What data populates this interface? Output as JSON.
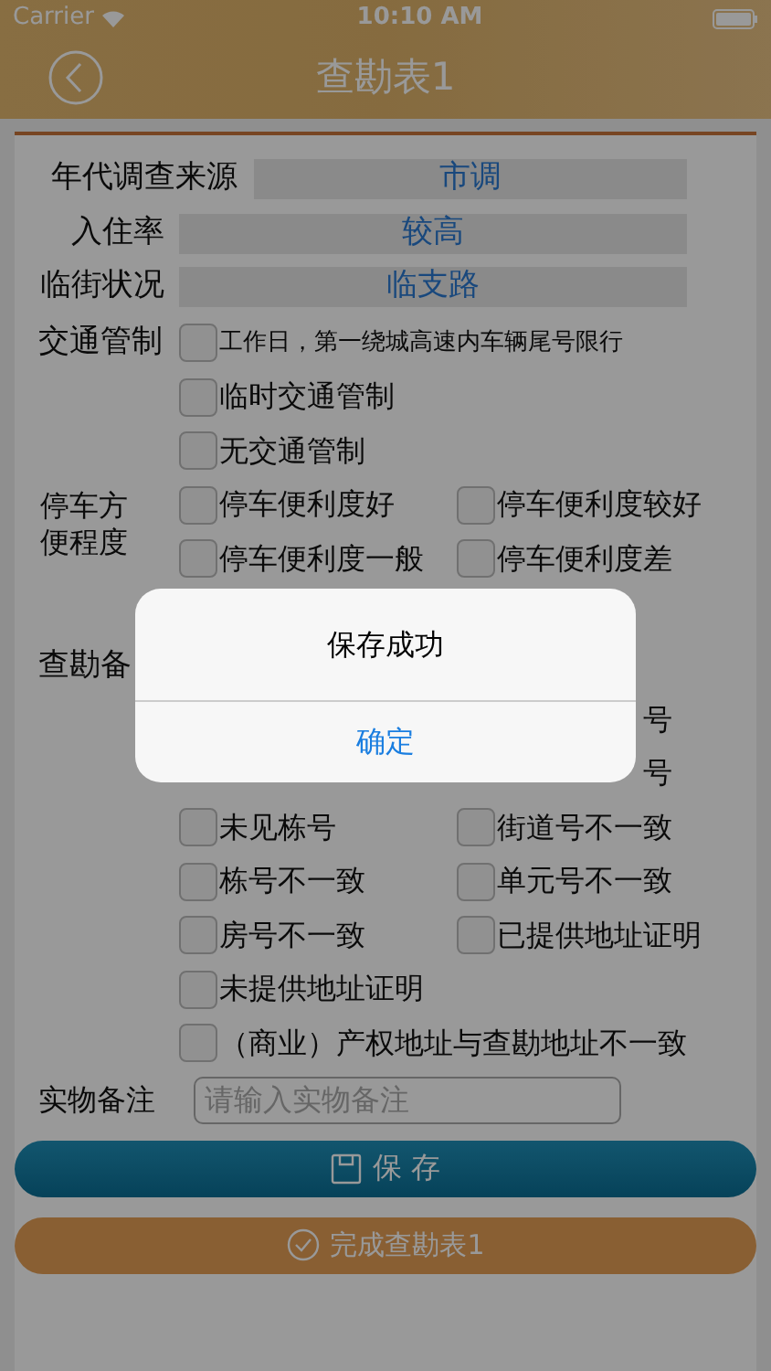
{
  "status_bar": {
    "carrier": "Carrier",
    "time": "10:10 AM"
  },
  "nav": {
    "title": "查勘表1"
  },
  "fields": [
    {
      "label": "年代调查来源",
      "value": "市调"
    },
    {
      "label": "入住率",
      "value": "较高"
    },
    {
      "label": "临街状况",
      "value": "临支路"
    }
  ],
  "traffic": {
    "label": "交通管制",
    "options": [
      {
        "label": "工作日，第一绕城高速内车辆尾号限行",
        "checked": false
      },
      {
        "label": "临时交通管制",
        "checked": false
      },
      {
        "label": "无交通管制",
        "checked": false
      }
    ]
  },
  "parking": {
    "label_lines": [
      "停车方",
      "便程度"
    ],
    "options": [
      {
        "label": "停车便利度好",
        "checked": false
      },
      {
        "label": "停车便利度较好",
        "checked": false
      },
      {
        "label": "停车便利度一般",
        "checked": false
      },
      {
        "label": "停车便利度差",
        "checked": false
      }
    ]
  },
  "remarks": {
    "label": "查勘备",
    "partial_texts": [
      "号",
      "号"
    ],
    "options": [
      {
        "label": "未见栋号",
        "checked": false
      },
      {
        "label": "街道号不一致",
        "checked": false
      },
      {
        "label": "栋号不一致",
        "checked": false
      },
      {
        "label": "单元号不一致",
        "checked": false
      },
      {
        "label": "房号不一致",
        "checked": false
      },
      {
        "label": "已提供地址证明",
        "checked": false
      },
      {
        "label": "未提供地址证明",
        "checked": false
      }
    ],
    "wide_option": {
      "label": "（商业）产权地址与查勘地址不一致",
      "checked": false
    }
  },
  "note": {
    "label": "实物备注",
    "placeholder": "请输入实物备注"
  },
  "buttons": {
    "save": "保 存",
    "finish": "完成查勘表1"
  },
  "alert": {
    "title": "保存成功",
    "button": "确定"
  }
}
